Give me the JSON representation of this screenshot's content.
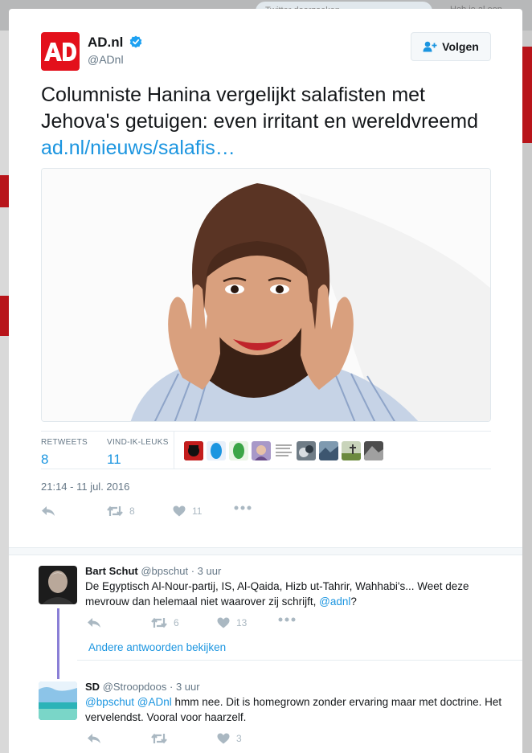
{
  "background": {
    "search_placeholder": "Twitter doorzoeken",
    "login_text": "Heb je al een account?"
  },
  "tweet": {
    "author_name": "AD.nl",
    "author_handle": "@ADnl",
    "logo_text": "AD",
    "follow_label": "Volgen",
    "text": "Columniste Hanina vergelijkt salafisten met Jehova's getuigen: even irritant en wereldvreemd ",
    "link_text": "ad.nl/nieuws/salafis…",
    "retweets_label": "RETWEETS",
    "retweets": "8",
    "likes_label": "VIND-IK-LEUKS",
    "likes": "11",
    "timestamp": "21:14 - 11 jul. 2016",
    "action_retweets": "8",
    "action_likes": "11"
  },
  "replies": [
    {
      "name": "Bart Schut",
      "handle": "@bpschut",
      "time": "· 3 uur",
      "text": "De Egyptisch Al-Nour-partij, IS, Al-Qaida, Hizb ut-Tahrir, Wahhabi's... Weet deze mevrouw dan helemaal niet waarover zij schrijft, ",
      "mention": "@adnl",
      "text_end": "?",
      "retweets": "6",
      "likes": "13"
    },
    {
      "name": "SD",
      "handle": "@Stroopdoos",
      "time": "· 3 uur",
      "mention1": "@bpschut",
      "mention2": "@ADnl",
      "text": " hmm nee. Dit is homegrown zonder ervaring maar met doctrine. Het vervelendst. Vooral voor haarzelf.",
      "retweets": "",
      "likes": "3"
    }
  ],
  "more_replies_label": "Andere antwoorden bekijken",
  "colors": {
    "accent": "#1b95e0",
    "brand_red": "#e3101b",
    "muted": "#657786",
    "icon": "#aab8c2",
    "thread_line": "#8a7fd6"
  }
}
